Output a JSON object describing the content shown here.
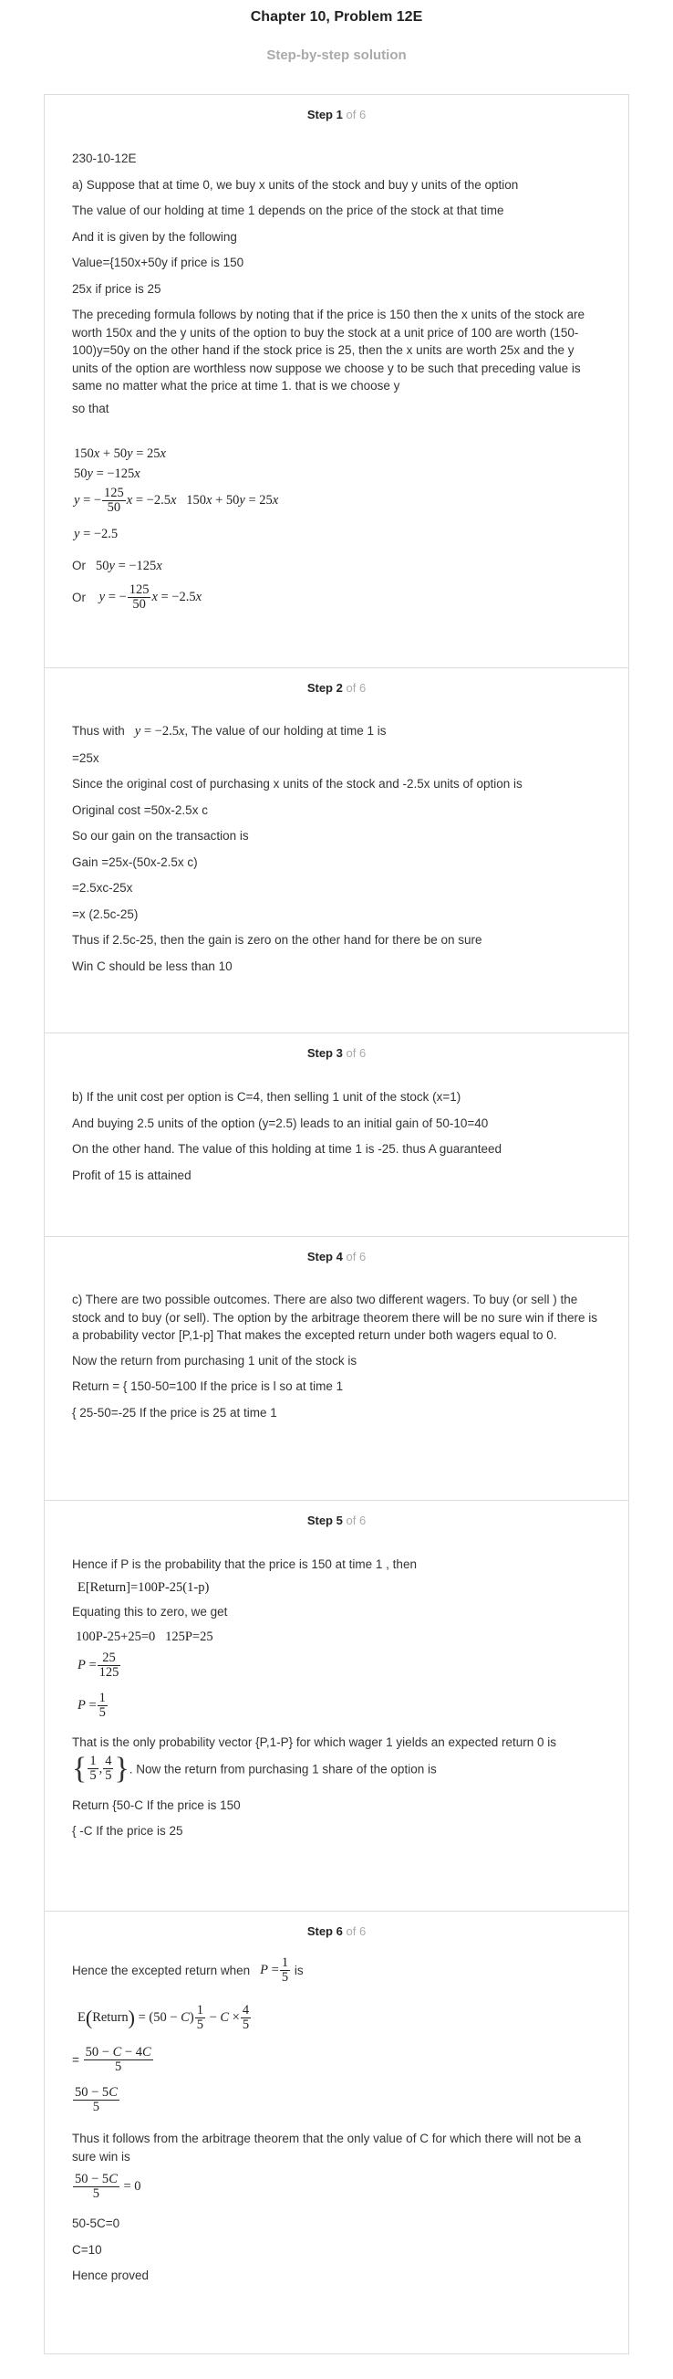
{
  "header": {
    "title": "Chapter 10, Problem 12E",
    "subtitle": "Step-by-step solution"
  },
  "step_label_prefix": "Step",
  "steps": [
    {
      "number": "1",
      "of": "of 6",
      "lines": [
        "230-10-12E",
        "a) Suppose that at time 0, we buy x units of the stock and buy y units of the option",
        "The value of our holding at time 1 depends on the price of the stock at that time",
        "And it is given by the following",
        "Value={150x+50y if price is 150",
        "25x if price is 25",
        "The preceding formula follows by noting that if the price is 150 then the x units of the stock are worth 150x and the y units of the option to buy the stock at a unit price of 100 are worth (150-100)y=50y on the other hand if the stock price is 25, then the x units are worth 25x and the y units of the option are worthless now suppose we choose y to be such that preceding value is same no matter what the price at time 1. that is we choose y",
        "so that",
        "Or",
        "Or"
      ]
    },
    {
      "number": "2",
      "of": "of 6",
      "lines": [
        "Thus with",
        ", The value of our holding at time 1 is",
        "=25x",
        "Since the original cost of purchasing x units of the stock and -2.5x units of option is",
        "Original cost =50x-2.5x c",
        "So our gain on the transaction is",
        "Gain =25x-(50x-2.5x c)",
        "=2.5xc-25x",
        "=x (2.5c-25)",
        "Thus if 2.5c-25, then the gain is zero on the other hand for there be on sure",
        "Win C should be less than 10"
      ]
    },
    {
      "number": "3",
      "of": "of 6",
      "lines": [
        "b) If the unit cost per option is C=4, then selling 1 unit of the stock (x=1)",
        "And buying 2.5 units of the option (y=2.5) leads to an initial gain of 50-10=40",
        "On the other hand. The value of this holding at time 1 is -25. thus A guaranteed",
        "Profit of 15 is attained"
      ]
    },
    {
      "number": "4",
      "of": "of 6",
      "lines": [
        "c) There are two possible outcomes. There are also two different wagers. To buy (or sell ) the stock and to buy (or sell). The option by the arbitrage theorem there will be no sure win if there is a probability vector [P,1-p] That makes the excepted return under both wagers equal to 0.",
        "Now the return from purchasing 1 unit of the stock is",
        "Return = { 150-50=100 If the price is l so at time 1",
        "{ 25-50=-25 If the price is 25 at time 1"
      ]
    },
    {
      "number": "5",
      "of": "of 6",
      "lines": [
        "Hence if P is the probability that the price is 150 at time 1 , then",
        "E[Return]=100P-25(1-p)",
        "Equating this to zero, we get",
        "100P-25+25=0   125P=25",
        "That is the only probability vector {P,1-P} for which wager 1 yields an expected return 0 is",
        ". Now the return from purchasing 1 share of the option is",
        "Return {50-C If the price is 150",
        "{ -C If the price is 25"
      ]
    },
    {
      "number": "6",
      "of": "of 6",
      "lines": [
        "Hence the excepted return when",
        "is",
        "=",
        "Thus it follows from the arbitrage theorem that the only value of C for which there will not be a sure win is",
        "50-5C=0",
        "C=10",
        "Hence proved"
      ]
    }
  ]
}
